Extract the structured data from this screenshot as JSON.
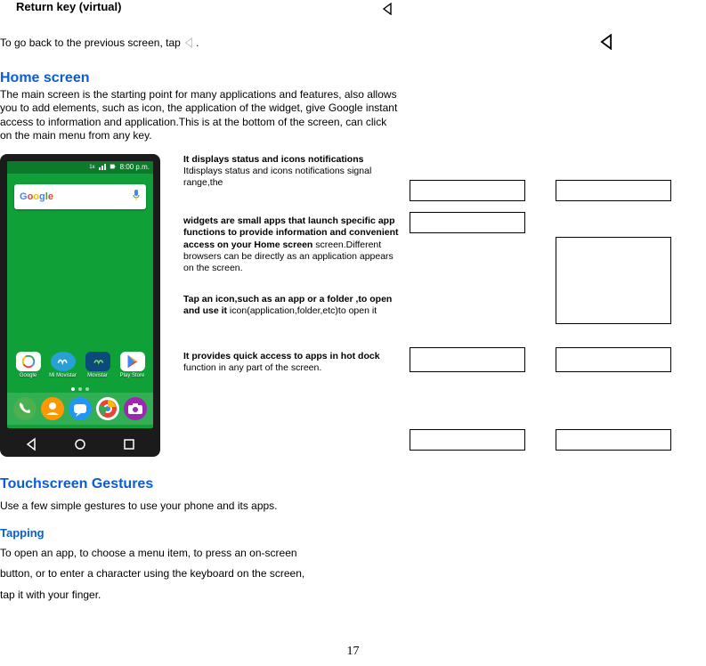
{
  "returnKey": {
    "title": "Return key (virtual)",
    "instruction_pre": "To go back to the previous screen, tap ",
    "instruction_post": "."
  },
  "homeScreen": {
    "heading": "Home screen",
    "description": "The main screen is the starting point for many applications and features, also allows you to add elements, such as icon, the application of the widget, give Google instant access to information and application.This is at the bottom of the screen, can click on the main menu from any key."
  },
  "phone": {
    "time": "8:00 p.m.",
    "searchBrand": "Google",
    "apps": [
      "Google",
      "Mi Movistar",
      "Movistar",
      "Play Store"
    ]
  },
  "callouts": [
    {
      "bold": "It displays status and icons notifications",
      "rest": " Itdisplays status and icons notifications signal range,the"
    },
    {
      "bold": "widgets are small apps that launch specific app functions to provide information and convenient access on your Home screen",
      "rest": " screen.Different browsers can be directly as an application appears on the screen."
    },
    {
      "bold": "Tap an icon,such as an app or a folder ,to open and use it",
      "rest": " icon(application,folder,etc)to open it"
    },
    {
      "bold": "It provides quick access to apps in hot dock",
      "rest": " function in any part of the screen."
    }
  ],
  "touchscreen": {
    "heading": "Touchscreen Gestures",
    "intro": "Use a few simple gestures to use your phone and its apps."
  },
  "tapping": {
    "heading": "Tapping",
    "line1": "To open an app, to choose a menu item, to press an on-screen",
    "line2": "button, or to enter a character using the keyboard on the screen,",
    "line3": "tap it with your finger."
  },
  "pageNumber": "17"
}
